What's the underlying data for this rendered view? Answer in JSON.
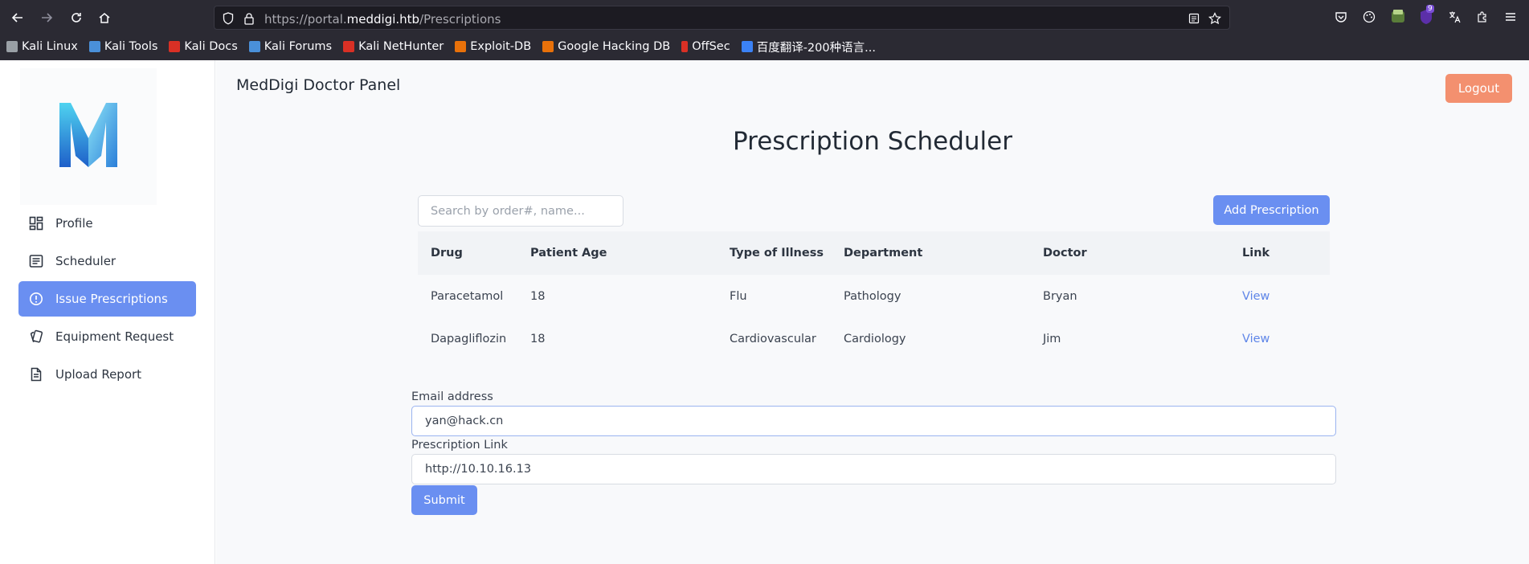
{
  "browser": {
    "url_prefix": "https://portal.",
    "url_host": "meddigi.htb",
    "url_path": "/Prescriptions",
    "bookmarks": [
      {
        "label": "Kali Linux",
        "color": "#9aa0a6"
      },
      {
        "label": "Kali Tools",
        "color": "#4a90d9"
      },
      {
        "label": "Kali Docs",
        "color": "#d93025"
      },
      {
        "label": "Kali Forums",
        "color": "#4a90d9"
      },
      {
        "label": "Kali NetHunter",
        "color": "#d93025"
      },
      {
        "label": "Exploit-DB",
        "color": "#e8710a"
      },
      {
        "label": "Google Hacking DB",
        "color": "#e8710a"
      },
      {
        "label": "OffSec",
        "color": "#d93025"
      },
      {
        "label": "百度翻译-200种语言...",
        "color": "#3b82f6"
      }
    ],
    "extension_badge": "9"
  },
  "sidebar": {
    "items": [
      {
        "label": "Profile",
        "icon": "dashboard-icon"
      },
      {
        "label": "Scheduler",
        "icon": "list-icon"
      },
      {
        "label": "Issue Prescriptions",
        "icon": "alert-circle-icon",
        "active": true
      },
      {
        "label": "Equipment Request",
        "icon": "cards-icon"
      },
      {
        "label": "Upload Report",
        "icon": "document-icon"
      }
    ]
  },
  "header": {
    "title": "MedDigi Doctor Panel",
    "logout_label": "Logout"
  },
  "main": {
    "title": "Prescription Scheduler",
    "search_placeholder": "Search by order#, name...",
    "add_label": "Add Prescription"
  },
  "table": {
    "columns": [
      "Drug",
      "Patient Age",
      "Type of Illness",
      "Department",
      "Doctor",
      "Link"
    ],
    "rows": [
      [
        "Paracetamol",
        "18",
        "Flu",
        "Pathology",
        "Bryan",
        "View"
      ],
      [
        "Dapagliflozin",
        "18",
        "Cardiovascular",
        "Cardiology",
        "Jim",
        "View"
      ]
    ]
  },
  "form": {
    "email_label": "Email address",
    "email_value": "yan@hack.cn",
    "link_label": "Prescription Link",
    "link_value": "http://10.10.16.13",
    "submit_label": "Submit"
  },
  "colors": {
    "accent": "#6a8ff1",
    "logout": "#f3906f",
    "link": "#5f86e8"
  }
}
